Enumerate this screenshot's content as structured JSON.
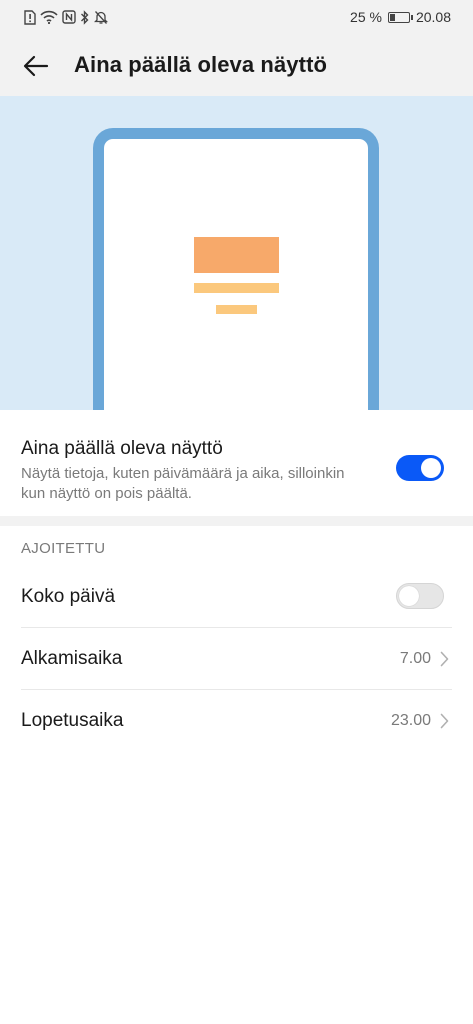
{
  "status_bar": {
    "battery_percent": "25 %",
    "battery_level": 0.25,
    "time": "20.08",
    "icons": [
      "sim-alert-icon",
      "wifi-icon",
      "nfc-icon",
      "bluetooth-icon",
      "bell-off-icon"
    ]
  },
  "app_bar": {
    "title": "Aina päällä oleva näyttö",
    "back_icon": "arrow-left-icon"
  },
  "illustration": {
    "bg_color": "#d9eaf7",
    "frame_color": "#6aa7d8",
    "block_colors": [
      "#f7a96a",
      "#fbc87d",
      "#fbc87d"
    ]
  },
  "aod_setting": {
    "title": "Aina päällä oleva näyttö",
    "description": "Näytä tietoja, kuten päivämäärä ja aika, silloinkin kun näyttö on pois päältä.",
    "enabled": true,
    "accent_color": "#0a59f7"
  },
  "schedule": {
    "header": "AJOITETTU",
    "all_day": {
      "label": "Koko päivä",
      "enabled": false
    },
    "start_time": {
      "label": "Alkamisaika",
      "value": "7.00"
    },
    "end_time": {
      "label": "Lopetusaika",
      "value": "23.00"
    }
  }
}
